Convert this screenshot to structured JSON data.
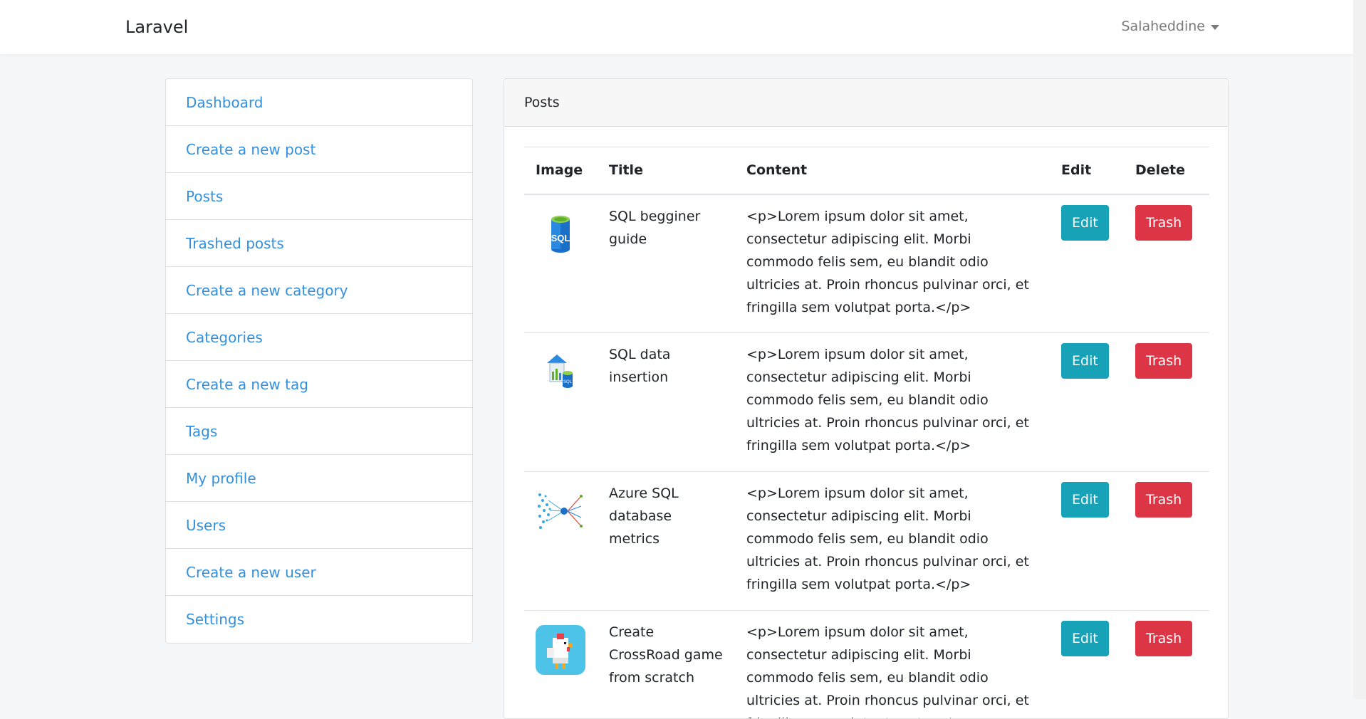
{
  "navbar": {
    "brand": "Laravel",
    "user": "Salaheddine"
  },
  "sidebar": {
    "items": [
      {
        "label": "Dashboard"
      },
      {
        "label": "Create a new post"
      },
      {
        "label": "Posts"
      },
      {
        "label": "Trashed posts"
      },
      {
        "label": "Create a new category"
      },
      {
        "label": "Categories"
      },
      {
        "label": "Create a new tag"
      },
      {
        "label": "Tags"
      },
      {
        "label": "My profile"
      },
      {
        "label": "Users"
      },
      {
        "label": "Create a new user"
      },
      {
        "label": "Settings"
      }
    ]
  },
  "card": {
    "header": "Posts",
    "columns": [
      "Image",
      "Title",
      "Content",
      "Edit",
      "Delete"
    ],
    "rows": [
      {
        "icon": "sql-database-icon",
        "title": "SQL begginer guide",
        "content": "<p>Lorem ipsum dolor sit amet, consectetur adipiscing elit. Morbi commodo felis sem, eu blandit odio ultricies at. Proin rhoncus pulvinar orci, et fringilla sem volutpat porta.</p>",
        "edit": "Edit",
        "delete": "Trash"
      },
      {
        "icon": "sql-data-warehouse-icon",
        "title": "SQL data insertion",
        "content": "<p>Lorem ipsum dolor sit amet, consectetur adipiscing elit. Morbi commodo felis sem, eu blandit odio ultricies at. Proin rhoncus pulvinar orci, et fringilla sem volutpat porta.</p>",
        "edit": "Edit",
        "delete": "Trash"
      },
      {
        "icon": "azure-metrics-icon",
        "title": "Azure SQL database metrics",
        "content": "<p>Lorem ipsum dolor sit amet, consectetur adipiscing elit. Morbi commodo felis sem, eu blandit odio ultricies at. Proin rhoncus pulvinar orci, et fringilla sem volutpat porta.</p>",
        "edit": "Edit",
        "delete": "Trash"
      },
      {
        "icon": "crossroad-chicken-icon",
        "title": "Create CrossRoad game from scratch",
        "content": "<p>Lorem ipsum dolor sit amet, consectetur adipiscing elit. Morbi commodo felis sem, eu blandit odio ultricies at. Proin rhoncus pulvinar orci, et fringilla sem volutpat porta.</p>",
        "edit": "Edit",
        "delete": "Trash"
      }
    ]
  },
  "colors": {
    "link": "#3490dc",
    "edit": "#17a2b8",
    "trash": "#dc3545",
    "background": "#f5f8fa"
  }
}
